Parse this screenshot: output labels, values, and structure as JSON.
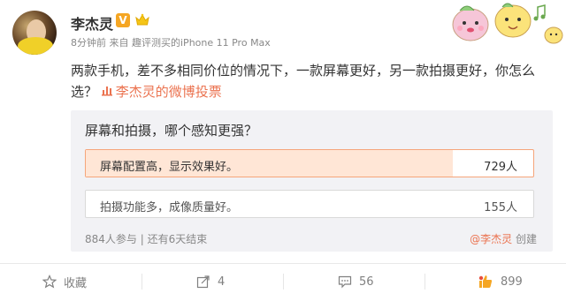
{
  "user": {
    "name": "李杰灵",
    "verified_badge": "V",
    "badge_color": "#f5a623"
  },
  "meta": {
    "time": "8分钟前",
    "source_prefix": "来自",
    "source": "趣评测买的iPhone 11 Pro Max"
  },
  "post": {
    "text": "两款手机，差不多相同价位的情况下，一款屏幕更好，另一款拍摄更好，你怎么选？",
    "vote_link": "李杰灵的微博投票",
    "accent": "#eb7350"
  },
  "poll": {
    "question": "屏幕和拍摄，哪个感知更强？",
    "options": [
      {
        "label": "屏幕配置高，显示效果好。",
        "count": "729人",
        "share": 0.82
      },
      {
        "label": "拍摄功能多，成像质量好。",
        "count": "155人",
        "share": 0.0
      }
    ],
    "footer": "884人参与 | 还有6天结束",
    "creator_at": "@李杰灵",
    "creator_suffix": "创建"
  },
  "actions": {
    "favorite": "收藏",
    "forward": "4",
    "comment": "56",
    "like": "899"
  }
}
